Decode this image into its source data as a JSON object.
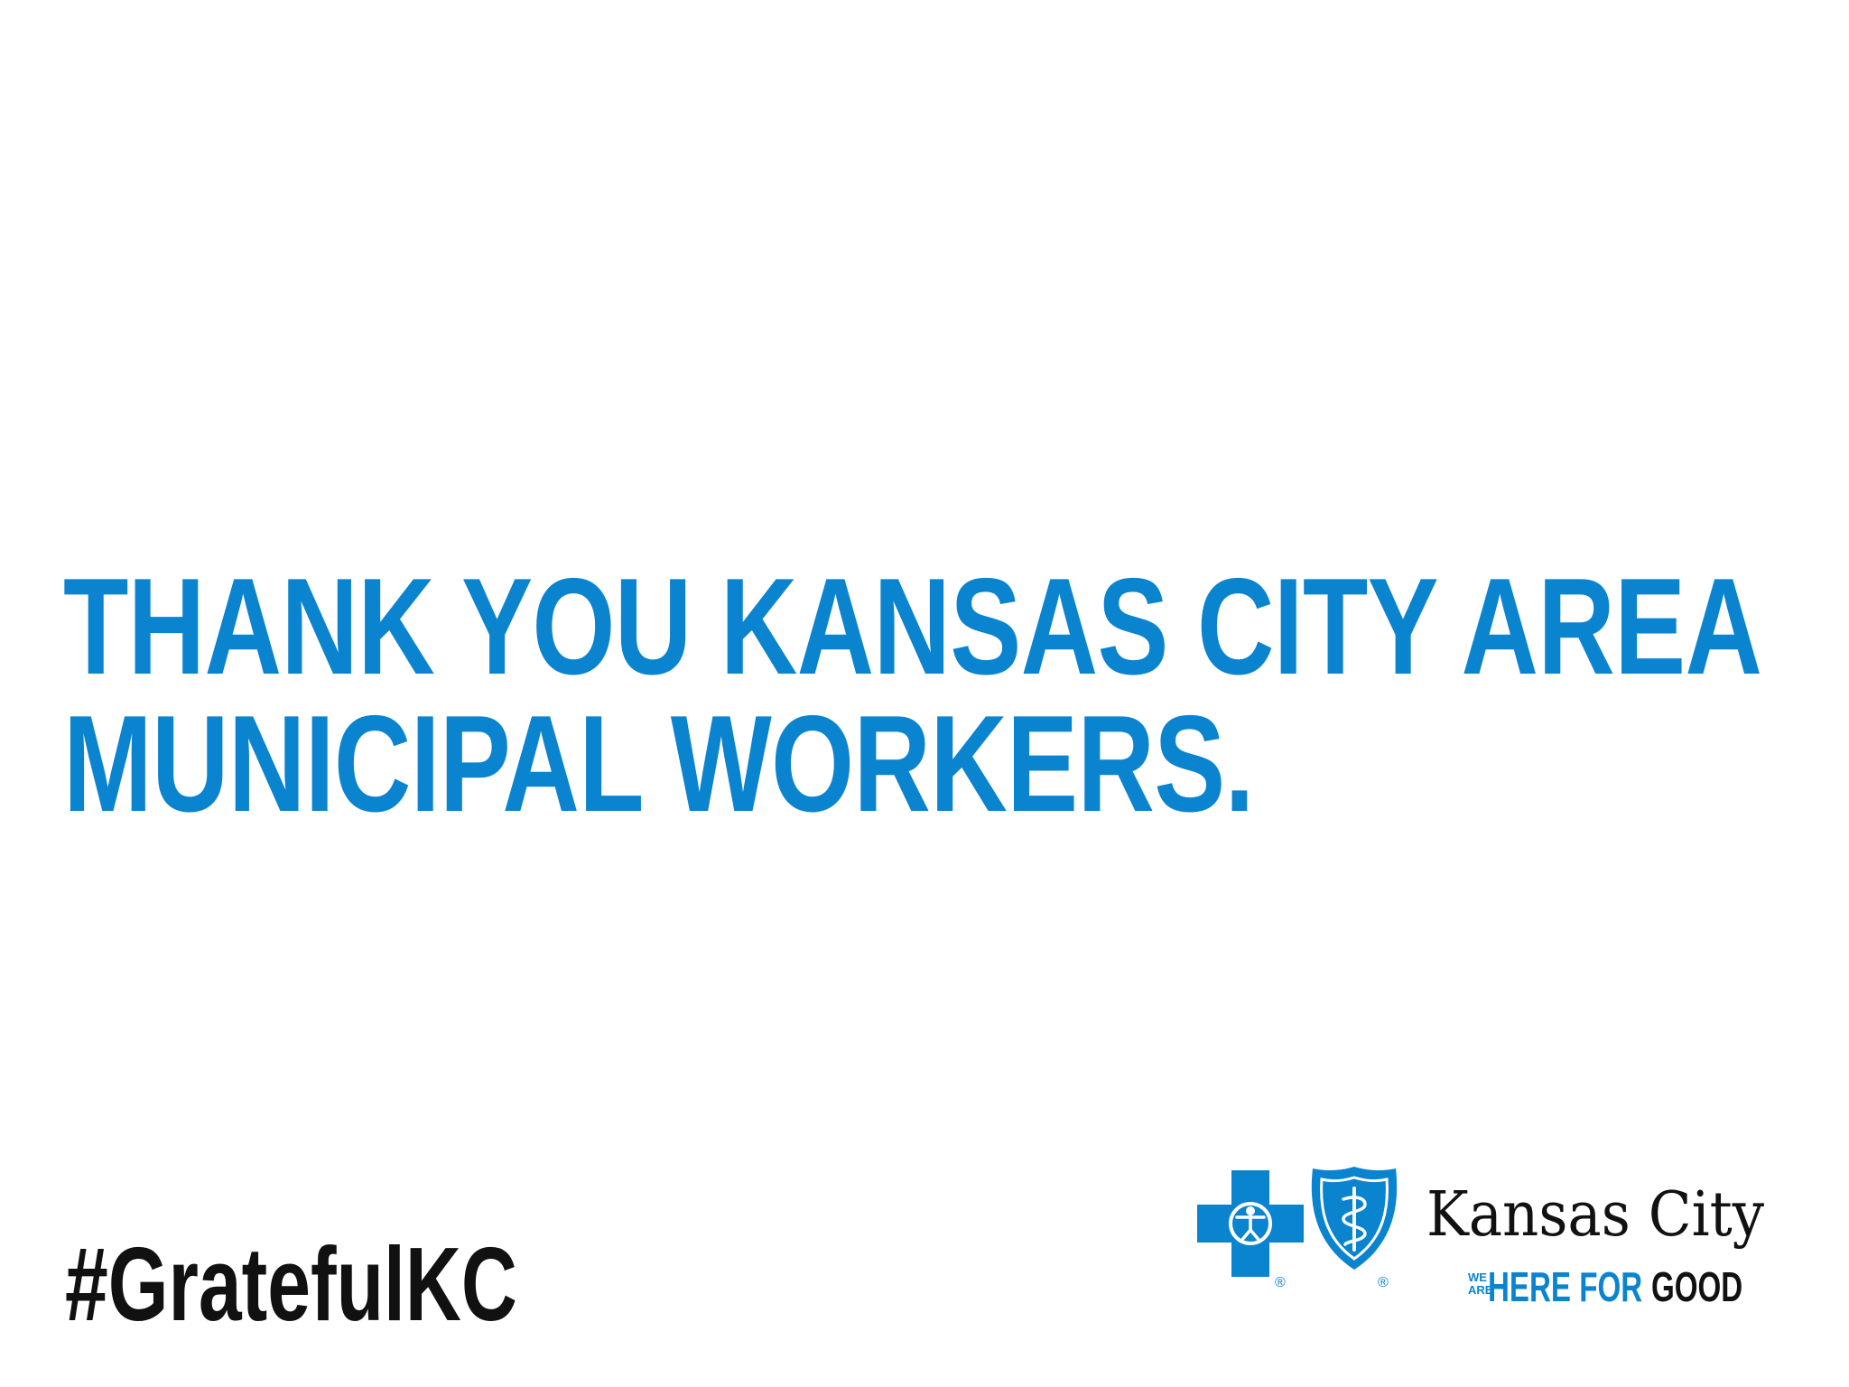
{
  "headline": {
    "line1": "THANK YOU KANSAS CITY AREA",
    "line2": "MUNICIPAL WORKERS."
  },
  "hashtag": "#GratefulKC",
  "logo": {
    "brand_name": "Kansas City",
    "tagline_small_1": "WE",
    "tagline_small_2": "ARE",
    "tagline_blue": "HERE FOR",
    "tagline_dark": "GOOD",
    "registered_mark": "®",
    "icons": [
      "blue-cross-icon",
      "blue-shield-icon"
    ]
  },
  "colors": {
    "brand_blue": "#0b84cf",
    "text_dark": "#111111",
    "background": "#ffffff"
  }
}
